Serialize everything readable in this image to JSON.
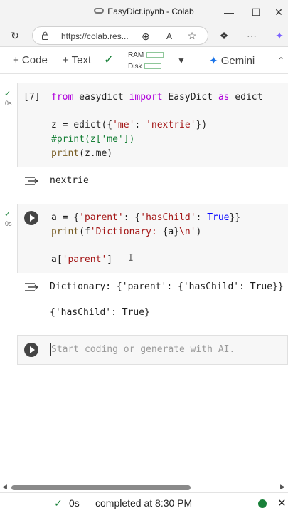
{
  "browser": {
    "tab_title": "EasyDict.ipynb - Colab",
    "url": "https://colab.res...",
    "icons": [
      "minimize-icon",
      "maximize-icon",
      "close-icon",
      "refresh-icon",
      "lock-icon",
      "zoom-icon",
      "read-aloud-icon",
      "favorite-icon",
      "extensions-icon",
      "more-icon",
      "copilot-icon"
    ]
  },
  "toolbar": {
    "code_label": "+ Code",
    "text_label": "+ Text",
    "ram_label": "RAM",
    "disk_label": "Disk",
    "gemini_label": "Gemini"
  },
  "cells": [
    {
      "exec_count": "[7]",
      "time": "0s",
      "code_lines": [
        "from easydict import EasyDict as edict",
        "",
        "z = edict({'me': 'nextrie'})",
        "#print(z['me'])",
        "print(z.me)"
      ],
      "output": [
        "nextrie"
      ]
    },
    {
      "time": "0s",
      "code_lines": [
        "a = {'parent': {'hasChild': True}}",
        "print(f'Dictionary: {a}\\n')",
        "",
        "a['parent']"
      ],
      "output": [
        "Dictionary: {'parent': {'hasChild': True}}",
        "",
        "{'hasChild': True}"
      ]
    }
  ],
  "new_cell": {
    "placeholder_start": "Start coding or ",
    "placeholder_link": "generate",
    "placeholder_end": " with AI."
  },
  "status": {
    "time": "0s",
    "text": "completed at 8:30 PM"
  },
  "colors": {
    "accent_green": "#188038",
    "gemini_blue": "#1a73e8"
  }
}
